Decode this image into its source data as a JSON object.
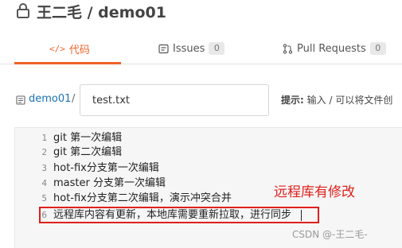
{
  "header": {
    "title": "王二毛 / demo01"
  },
  "tabs": [
    {
      "label": "代码",
      "icon": "code-icon",
      "active": true
    },
    {
      "label": "Issues",
      "icon": "issue-icon",
      "count": "0"
    },
    {
      "label": "Pull Requests",
      "icon": "pull-request-icon",
      "count": "0"
    }
  ],
  "breadcrumb": {
    "repo": "demo01",
    "separator": "/"
  },
  "filename": {
    "value": "test.txt"
  },
  "hint": {
    "label": "提示:",
    "text": "输入 / 可以将文件创"
  },
  "editor": {
    "lines": [
      {
        "num": "1",
        "text": "git 第一次编辑"
      },
      {
        "num": "2",
        "text": "git 第二次编辑"
      },
      {
        "num": "3",
        "text": "hot-fix分支第一次编辑"
      },
      {
        "num": "4",
        "text": "master 分支第一次编辑"
      },
      {
        "num": "5",
        "text": "hot-fix分支第二次编辑，演示冲突合并"
      },
      {
        "num": "6",
        "text": "远程库内容有更新，本地库需要重新拉取，进行同步"
      }
    ]
  },
  "annotation": {
    "text": "远程库有修改",
    "color": "#e0201b"
  },
  "watermark": "CSDN @-王二毛-",
  "colors": {
    "accent": "#f1622a",
    "link": "#1a73b4",
    "annotation": "#e0201b"
  }
}
